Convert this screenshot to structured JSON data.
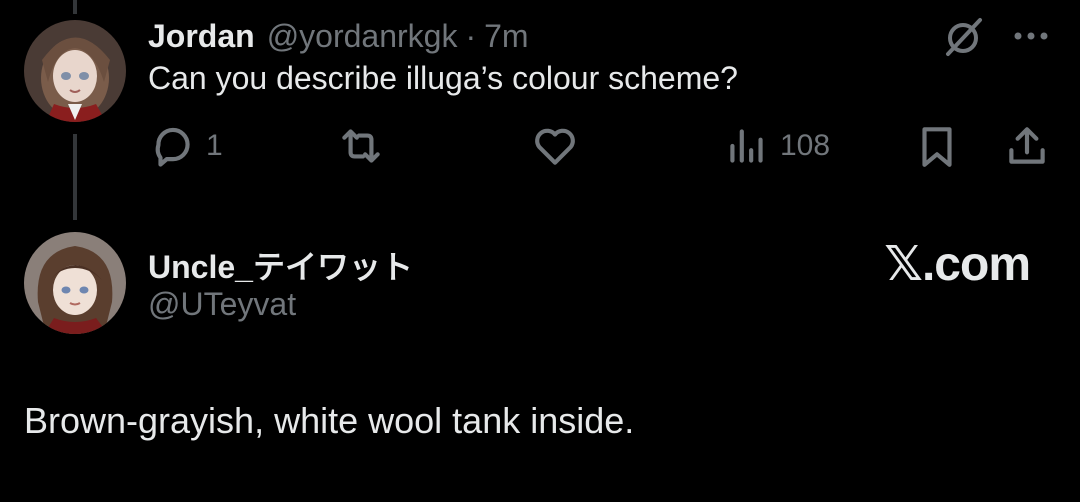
{
  "colors": {
    "background": "#000000",
    "primary_text": "#e7e9ea",
    "secondary_text": "#71767b",
    "thread_line": "#333639"
  },
  "tweet_1": {
    "name": "Jordan",
    "handle": "@yordanrkgk",
    "separator": "·",
    "time": "7m",
    "text": "Can you describe illuga’s colour scheme?",
    "avatar_icon": "avatar-anime-character",
    "top_icons": [
      "grok-icon",
      "more-options-icon"
    ],
    "actions": {
      "reply_count": "1",
      "repost_count": "",
      "like_count": "",
      "views_count": "108"
    }
  },
  "tweet_2": {
    "name": "Uncle_テイワット",
    "handle": "@UTeyvat",
    "text": "Brown-grayish, white wool tank inside.",
    "avatar_icon": "avatar-anime-character"
  },
  "watermark": "𝕏.com"
}
